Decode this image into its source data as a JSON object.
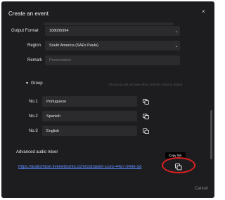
{
  "dialog": {
    "title": "Create an event",
    "close_glyph": "×",
    "cancel_label": "Cancel"
  },
  "form": {
    "output_format": {
      "label": "Output Format",
      "value": "108006994"
    },
    "region": {
      "label": "Region",
      "value": "South America (SÃ£o Paulo)"
    },
    "remark": {
      "label": "Remark",
      "placeholder": "Presentation"
    }
  },
  "group": {
    "label": "Group",
    "hint": "The group will not take effect until the name is added.",
    "rows": [
      {
        "label": "No.1",
        "value": "Portuguese"
      },
      {
        "label": "No.2",
        "value": "Spanish"
      },
      {
        "label": "No.3",
        "value": "English"
      }
    ]
  },
  "advanced_mixer": {
    "title": "Advanced audio mixer",
    "link": "https://audiomixer.livenetworks.com/cd1fade0-1ce5-44d7-849e-5d",
    "tooltip": "Copy link"
  },
  "icons": {
    "chevron": "chevron-down-icon",
    "copy": "copy-icon"
  },
  "colors": {
    "background": "#1d1d1f",
    "field": "#2b2b2d",
    "link": "#5b8cff",
    "highlight": "#e02020"
  }
}
